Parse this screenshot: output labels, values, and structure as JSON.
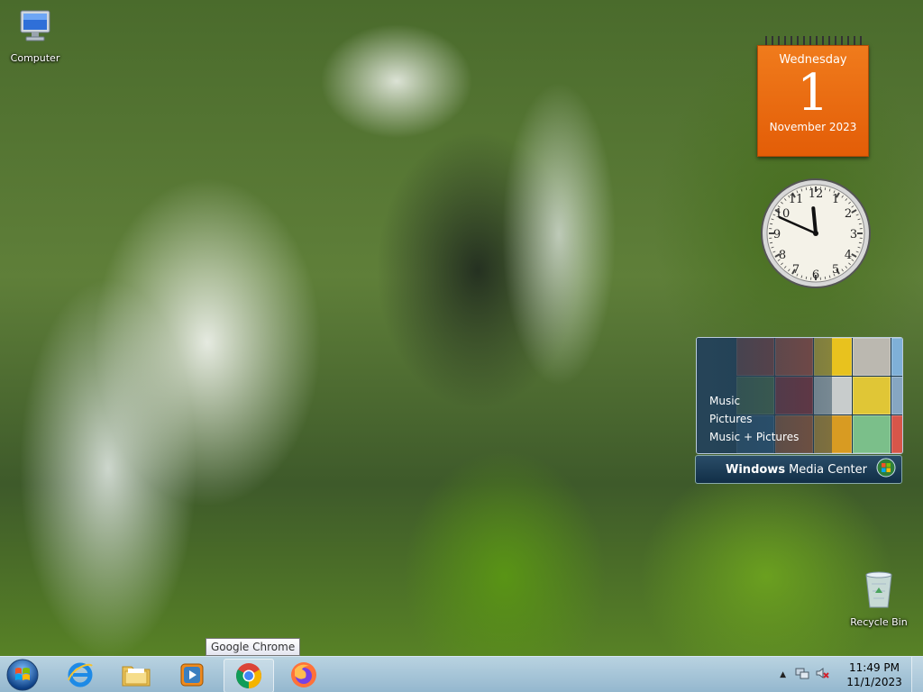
{
  "desktop": {
    "icons": [
      {
        "label": "Computer",
        "icon": "computer-icon"
      },
      {
        "label": "Recycle Bin",
        "icon": "recycle-bin-icon"
      }
    ]
  },
  "gadgets": {
    "calendar": {
      "weekday": "Wednesday",
      "day": "1",
      "month_year": "November 2023",
      "color": "#e8650e"
    },
    "clock": {
      "time": "11:49"
    },
    "media_center": {
      "menu": [
        "Music",
        "Pictures",
        "Music + Pictures"
      ],
      "brand_bold": "Windows",
      "brand_light": "Media Center"
    }
  },
  "tooltip": {
    "text": "Google Chrome"
  },
  "taskbar": {
    "start": {
      "icon": "windows-start-icon"
    },
    "pinned": [
      {
        "name": "Internet Explorer",
        "icon": "internet-explorer-icon"
      },
      {
        "name": "Windows Explorer",
        "icon": "folder-icon"
      },
      {
        "name": "Windows Media Player",
        "icon": "media-player-icon"
      },
      {
        "name": "Google Chrome",
        "icon": "chrome-icon"
      },
      {
        "name": "Firefox",
        "icon": "firefox-icon"
      }
    ],
    "tray": {
      "time": "11:49 PM",
      "date": "11/1/2023",
      "icons": [
        "show-hidden-icons-icon",
        "network-icon",
        "volume-muted-icon"
      ]
    }
  }
}
